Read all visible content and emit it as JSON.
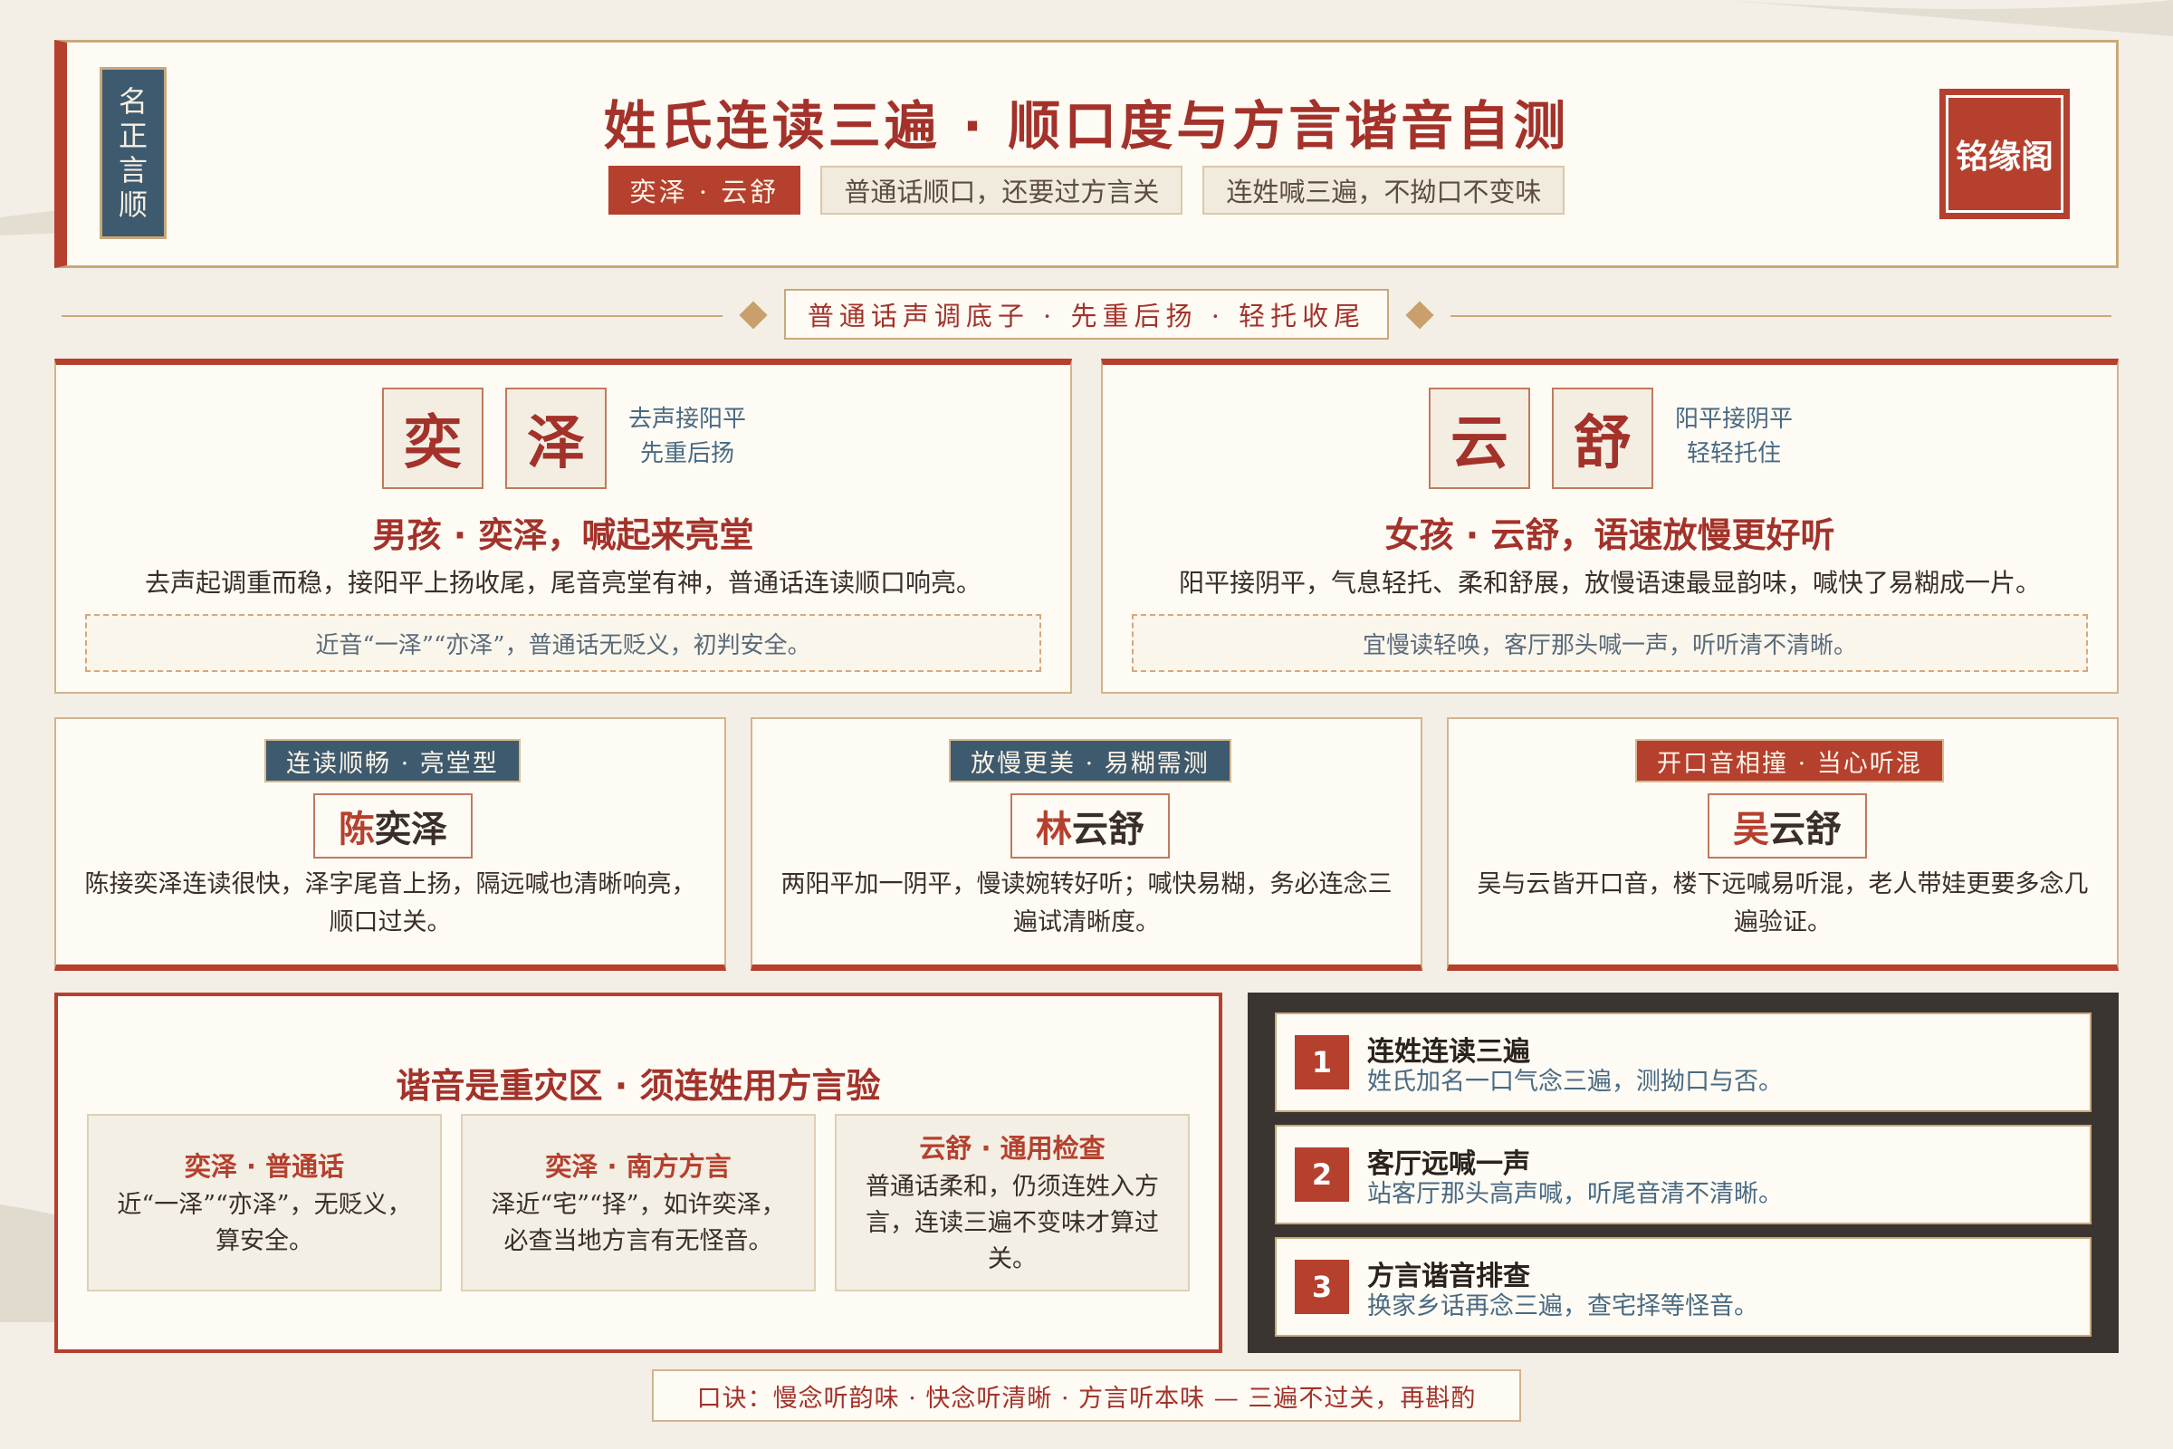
{
  "header": {
    "seal_left": "名正言顺",
    "title": "姓氏连读三遍 · 顺口度与方言谐音自测",
    "tags": [
      "奕泽 · 云舒",
      "普通话顺口，还要过方言关",
      "连姓喊三遍，不拗口不变味"
    ],
    "seal_right": "铭缘阁"
  },
  "motto": "普通话声调底子 · 先重后扬 · 轻托收尾",
  "name_cards": [
    {
      "chars": [
        "奕",
        "泽"
      ],
      "tone_line1": "去声接阳平",
      "tone_line2": "先重后扬",
      "title": "男孩 · 奕泽，喊起来亮堂",
      "desc": "去声起调重而稳，接阳平上扬收尾，尾音亮堂有神，普通话连读顺口响亮。",
      "note": "近音“一泽”“亦泽”，普通话无贬义，初判安全。"
    },
    {
      "chars": [
        "云",
        "舒"
      ],
      "tone_line1": "阳平接阴平",
      "tone_line2": "轻轻托住",
      "title": "女孩 · 云舒，语速放慢更好听",
      "desc": "阳平接阴平，气息轻托、柔和舒展，放慢语速最显韵味，喊快了易糊成一片。",
      "note": "宜慢读轻唤，客厅那头喊一声，听听清不清晰。"
    }
  ],
  "full_cards": [
    {
      "tag": "连读顺畅 · 亮堂型",
      "surname": "陈",
      "given": "奕泽",
      "desc": "陈接奕泽连读很快，泽字尾音上扬，隔远喊也清晰响亮，顺口过关。",
      "tag_color": "#3e5a6e"
    },
    {
      "tag": "放慢更美 · 易糊需测",
      "surname": "林",
      "given": "云舒",
      "desc": "两阳平加一阴平，慢读婉转好听；喊快易糊，务必连念三遍试清晰度。",
      "tag_color": "#3e5a6e"
    },
    {
      "tag": "开口音相撞 · 当心听混",
      "surname": "吴",
      "given": "云舒",
      "desc": "吴与云皆开口音，楼下远喊易听混，老人带娃更要多念几遍验证。",
      "tag_color": "#b5402e"
    }
  ],
  "homophone": {
    "title": "谐音是重灾区 · 须连姓用方言验",
    "items": [
      {
        "title": "奕泽 · 普通话",
        "text": "近“一泽”“亦泽”，无贬义，算安全。"
      },
      {
        "title": "奕泽 · 南方方言",
        "text": "泽近“宅”“择”，如许奕泽，必查当地方言有无怪音。"
      },
      {
        "title": "云舒 · 通用检查",
        "text": "普通话柔和，仍须连姓入方言，连读三遍不变味才算过关。"
      }
    ]
  },
  "steps": [
    {
      "num": "1",
      "title": "连姓连读三遍",
      "desc": "姓氏加名一口气念三遍，测拗口与否。"
    },
    {
      "num": "2",
      "title": "客厅远喊一声",
      "desc": "站客厅那头高声喊，听尾音清不清晰。"
    },
    {
      "num": "3",
      "title": "方言谐音排查",
      "desc": "换家乡话再念三遍，查宅择等怪音。"
    }
  ],
  "footer": "口诀：慢念听韵味 · 快念听清晰 · 方言听本味 — 三遍不过关，再斟酌",
  "colors": {
    "accent": "#b5402e",
    "ink_blue": "#3e5a6e",
    "gold": "#c9a97b",
    "paper": "#fdfbf4",
    "dark_panel": "#3a3530"
  }
}
